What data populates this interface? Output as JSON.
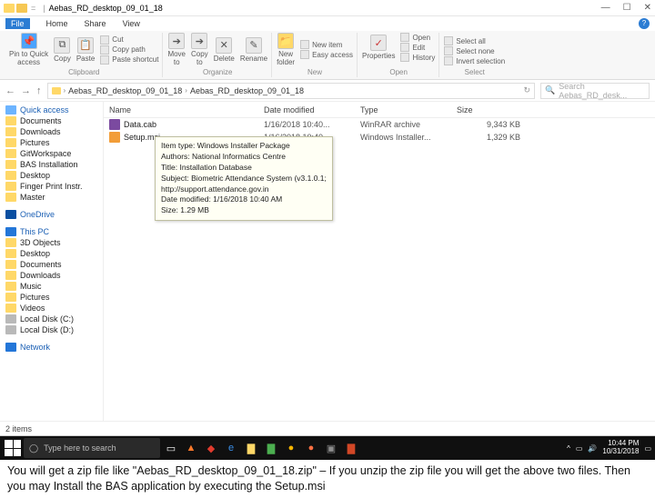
{
  "titlebar": {
    "path": "Aebas_RD_desktop_09_01_18"
  },
  "menus": {
    "file": "File",
    "home": "Home",
    "share": "Share",
    "view": "View"
  },
  "ribbon": {
    "clipboard": {
      "pin": "Pin to Quick\naccess",
      "copy": "Copy",
      "paste": "Paste",
      "cut": "Cut",
      "copypath": "Copy path",
      "shortcut": "Paste shortcut",
      "label": "Clipboard"
    },
    "organize": {
      "move": "Move\nto",
      "copy": "Copy\nto",
      "delete": "Delete",
      "rename": "Rename",
      "label": "Organize"
    },
    "new": {
      "folder": "New\nfolder",
      "item": "New item",
      "easy": "Easy access",
      "label": "New"
    },
    "open": {
      "properties": "Properties",
      "open": "Open",
      "edit": "Edit",
      "history": "History",
      "label": "Open"
    },
    "select": {
      "all": "Select all",
      "none": "Select none",
      "invert": "Invert selection",
      "label": "Select"
    }
  },
  "address": {
    "crumb1": "Aebas_RD_desktop_09_01_18",
    "crumb2": "Aebas_RD_desktop_09_01_18"
  },
  "search": {
    "placeholder": "Search Aebas_RD_desk..."
  },
  "columns": {
    "name": "Name",
    "date": "Date modified",
    "type": "Type",
    "size": "Size"
  },
  "sidebar": {
    "quick": "Quick access",
    "items_quick": [
      "Documents",
      "Downloads",
      "Pictures",
      "GitWorkspace",
      "BAS Installation",
      "Desktop",
      "Finger Print Instr.",
      "Master"
    ],
    "onedrive": "OneDrive",
    "thispc": "This PC",
    "items_pc": [
      "3D Objects",
      "Desktop",
      "Documents",
      "Downloads",
      "Music",
      "Pictures",
      "Videos",
      "Local Disk (C:)",
      "Local Disk (D:)"
    ],
    "network": "Network"
  },
  "files": [
    {
      "name": "Data.cab",
      "date": "1/16/2018 10:40...",
      "type": "WinRAR archive",
      "size": "9,343 KB",
      "icon": "zip"
    },
    {
      "name": "Setup.msi",
      "date": "1/16/2018 10:40...",
      "type": "Windows Installer...",
      "size": "1,329 KB",
      "icon": "msi"
    }
  ],
  "tooltip": {
    "l1": "Item type: Windows Installer Package",
    "l2": "Authors: National Informatics Centre",
    "l3": "Title: Installation Database",
    "l4": "Subject: Biometric Attendance System (v3.1.0.1;",
    "l5": "http://support.attendance.gov.in",
    "l6": "Date modified: 1/16/2018 10:40 AM",
    "l7": "Size: 1.29 MB"
  },
  "status": {
    "count": "2 items"
  },
  "taskbar": {
    "search": "Type here to search"
  },
  "tray": {
    "time": "10:44 PM",
    "date": "10/31/2018"
  },
  "caption": {
    "text": "You will get a zip file like \"Aebas_RD_desktop_09_01_18.zip\" – If you unzip the zip file you will get the  above two files. Then you may Install the BAS application by executing the Setup.msi"
  }
}
